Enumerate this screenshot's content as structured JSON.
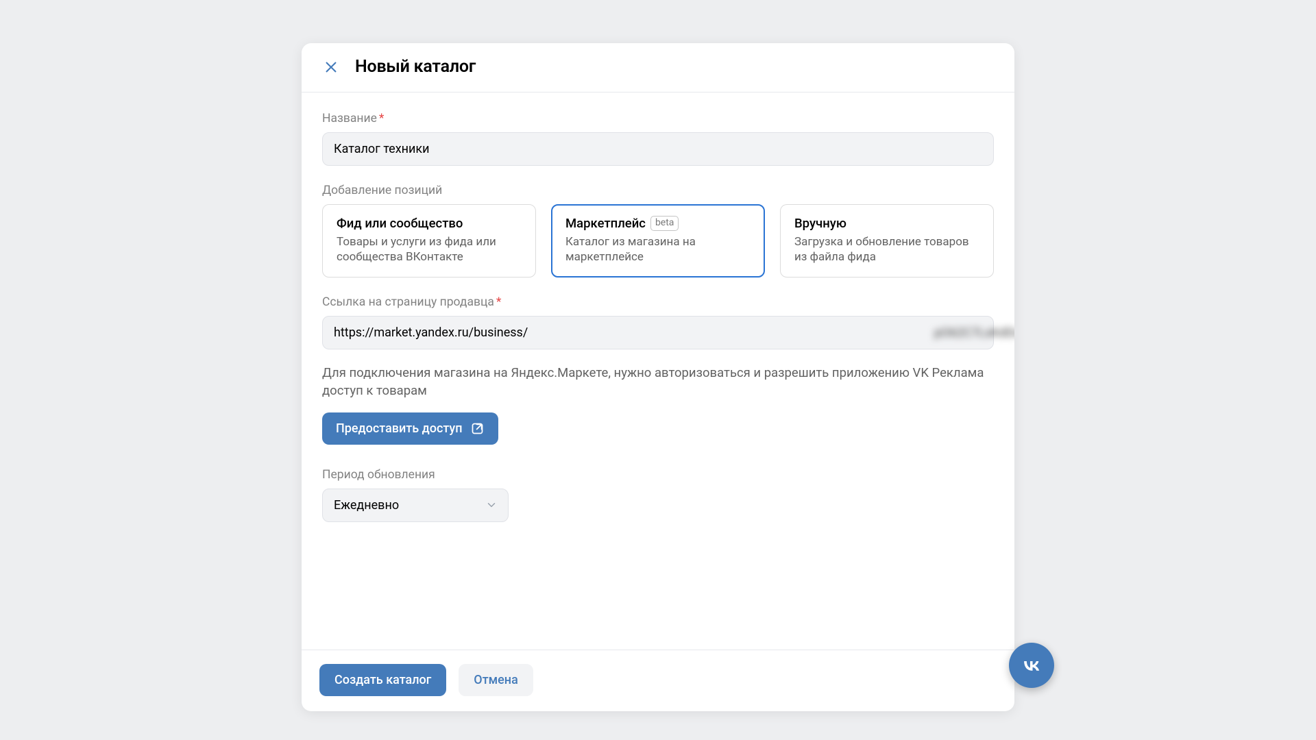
{
  "modal": {
    "title": "Новый каталог"
  },
  "name_field": {
    "label": "Название",
    "value": "Каталог техники"
  },
  "add_positions": {
    "label": "Добавление позиций",
    "options": [
      {
        "title": "Фид или сообщество",
        "desc": "Товары и услуги из фида или сообщества ВКонтакте"
      },
      {
        "title": "Маркетплейс",
        "badge": "beta",
        "desc": "Каталог из магазина на маркетплейсе"
      },
      {
        "title": "Вручную",
        "desc": "Загрузка и обновление товаров из файла фида"
      }
    ]
  },
  "seller_link": {
    "label": "Ссылка на страницу продавца",
    "value": "https://market.yandex.ru/business/",
    "blurred_suffix": "pO62C7LsKdDs_2D"
  },
  "access_info": "Для подключения магазина на Яндекс.Маркете, нужно авторизоваться и разрешить приложению VK Реклама доступ к товарам",
  "grant_button": "Предоставить доступ",
  "update_period": {
    "label": "Период обновления",
    "value": "Ежедневно"
  },
  "footer": {
    "create": "Создать каталог",
    "cancel": "Отмена"
  }
}
